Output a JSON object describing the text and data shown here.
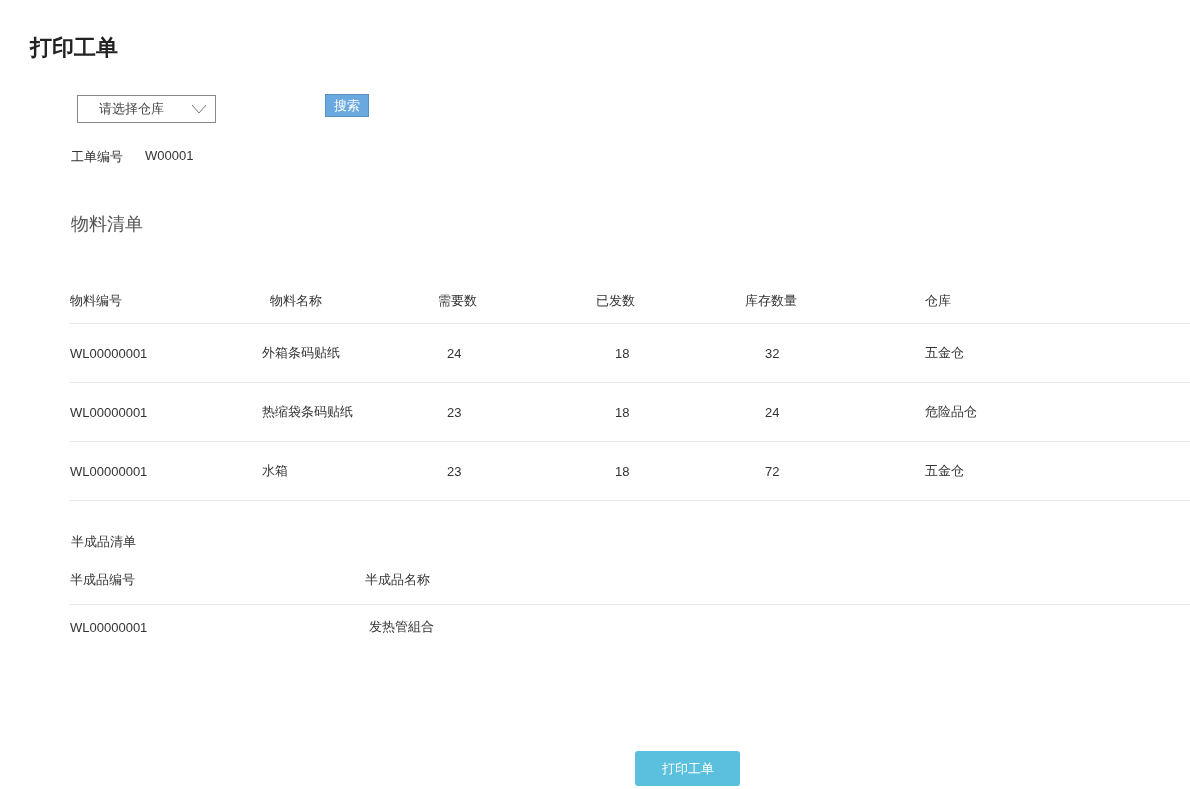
{
  "page_title": "打印工单",
  "warehouse_select": {
    "placeholder": "请选择仓库"
  },
  "search_button": "搜索",
  "work_order": {
    "label": "工单编号",
    "value": "W00001"
  },
  "materials": {
    "title": "物料清单",
    "columns": [
      "物料编号",
      "物料名称",
      "需要数",
      "已发数",
      "库存数量",
      "仓库"
    ],
    "rows": [
      [
        "WL00000001",
        "外箱条码贴纸",
        "24",
        "18",
        "32",
        "五金仓"
      ],
      [
        "WL00000001",
        "热缩袋条码贴纸",
        "23",
        "18",
        "24",
        "危险品仓"
      ],
      [
        "WL00000001",
        "水箱",
        "23",
        "18",
        "72",
        "五金仓"
      ]
    ]
  },
  "semi_products": {
    "title": "半成品清单",
    "columns": [
      "半成品编号",
      "半成品名称"
    ],
    "rows": [
      [
        "WL00000001",
        "发热管組合"
      ]
    ]
  },
  "print_button": "打印工单"
}
